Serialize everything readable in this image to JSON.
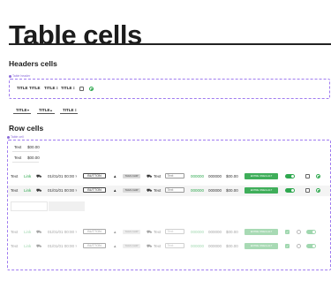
{
  "page": {
    "title": "Table cells"
  },
  "headers_section": {
    "heading": "Headers cells",
    "box_tag": "Table header",
    "header_row": {
      "col1": "TITLE",
      "col2": "TITLE",
      "col3": "TITLE",
      "col4": "TITLE"
    },
    "sort_titles": [
      "TITLE",
      "TITLE",
      "TITLE"
    ]
  },
  "rows_section": {
    "heading": "Row cells",
    "box_tag": "Table cell",
    "text_cells": [
      {
        "text": "Text",
        "value": "$00.00"
      },
      {
        "text": "Text",
        "value": "$00.00"
      }
    ],
    "rows": [
      {
        "text": "Text",
        "link": "Link",
        "date": "01/01/01 00:00",
        "button": "BUTTON",
        "chip": "TAGS CHIP",
        "truck_text": "Text",
        "field": "Text",
        "green_num": "000000",
        "num": "000000",
        "money": "$00.00",
        "green_button": "ENTRE ONE/A ALT"
      },
      {
        "text": "Text",
        "link": "Link",
        "date": "01/01/01 00:00",
        "button": "BUTTON",
        "chip": "TAGS CHIP",
        "truck_text": "Text",
        "field": "Text",
        "green_num": "000000",
        "num": "000000",
        "money": "$00.00",
        "green_button": "ENTRE ONE/A ALT"
      },
      {
        "text": "Text",
        "link": "Link",
        "date": "01/01/01 00:00",
        "button": "BUTTON",
        "chip": "TAGS CHIP",
        "truck_text": "Text",
        "field": "Text",
        "green_num": "000000",
        "num": "000000",
        "money": "$00.00",
        "green_button": "ENTRE ONE/A ALT"
      },
      {
        "text": "Text",
        "link": "Link",
        "date": "01/01/01 00:00",
        "button": "BUTTON",
        "chip": "TAGS CHIP",
        "truck_text": "Text",
        "field": "Text",
        "green_num": "000000",
        "num": "000000",
        "money": "$00.00",
        "green_button": "ENTRE ONE/A ALT"
      }
    ]
  },
  "colors": {
    "accent": "#2fa84f",
    "dashed_border": "#a07cf0",
    "chip": "#d8d8d8"
  }
}
